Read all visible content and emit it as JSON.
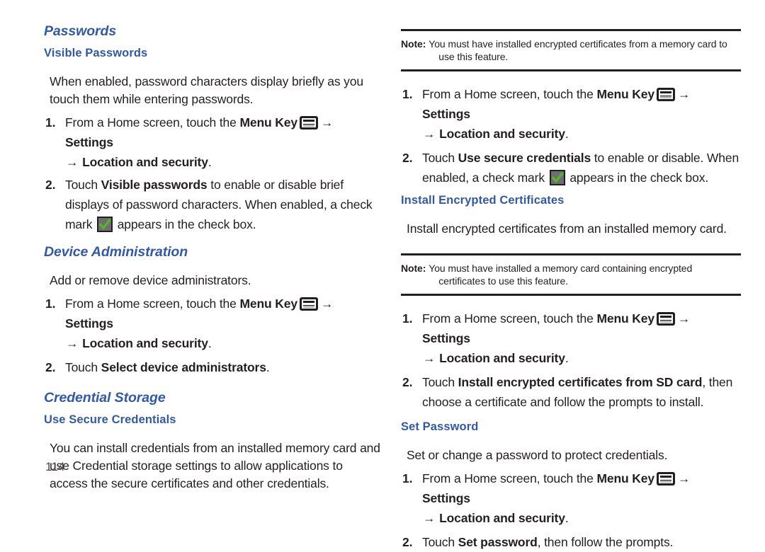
{
  "page": {
    "number": "114",
    "accent_color": "#3159a6",
    "text_color": "#231f20",
    "check_color": "#5ab031"
  },
  "icons": {
    "menu_key": "menu-key-icon",
    "check_box": "checkbox-checked-icon",
    "arrow": "→"
  },
  "left_column": {
    "heading_passwords": "Passwords",
    "subheading_visible_passwords": "Visible Passwords",
    "visible_passwords_intro": "When enabled, password characters display briefly as you touch them while entering passwords.",
    "vp_step1": {
      "num": "1.",
      "part_a": "From a Home screen, touch the ",
      "bold_menu_key": "Menu Key",
      "bold_settings": "Settings",
      "bold_location": "Location and security",
      "period": "."
    },
    "vp_step2": {
      "num": "2.",
      "part_a": "Touch ",
      "bold_target": "Visible passwords",
      "part_b": " to enable or disable brief displays of password characters. When enabled, a check mark ",
      "part_c": " appears in the check box."
    },
    "heading_device_administration": "Device Administration",
    "device_admin_intro": "Add or remove device administrators.",
    "da_step1": {
      "num": "1.",
      "part_a": "From a Home screen, touch the ",
      "bold_menu_key": "Menu Key",
      "bold_settings": "Settings",
      "bold_location": "Location and security",
      "period": "."
    },
    "da_step2": {
      "num": "2.",
      "part_a": "Touch ",
      "bold_target": "Select device administrators",
      "period": "."
    },
    "heading_credential_storage": "Credential Storage",
    "subheading_use_secure_credentials": "Use Secure Credentials",
    "use_secure_credentials_intro": "You can install credentials from an installed memory card and use Credential storage settings to allow applications to access the secure certificates and other credentials."
  },
  "right_column": {
    "note1": {
      "label": "Note:",
      "line1": "You must have installed encrypted certificates from a memory card to",
      "line2": "use this feature."
    },
    "usc_step1": {
      "num": "1.",
      "part_a": "From a Home screen, touch the ",
      "bold_menu_key": "Menu Key",
      "bold_settings": "Settings",
      "bold_location": "Location and security",
      "period": "."
    },
    "usc_step2": {
      "num": "2.",
      "part_a": "Touch ",
      "bold_target": "Use secure credentials",
      "part_b": " to enable or disable. When enabled, a check mark ",
      "part_c": " appears in the check box."
    },
    "subheading_install_encrypted_certificates": "Install Encrypted Certificates",
    "install_certificates_intro": "Install encrypted certificates from an installed memory card.",
    "note2": {
      "label": "Note:",
      "line1": "You must have installed a memory card containing encrypted",
      "line2": "certificates to use this feature."
    },
    "iec_step1": {
      "num": "1.",
      "part_a": "From a Home screen, touch the ",
      "bold_menu_key": "Menu Key",
      "bold_settings": "Settings",
      "bold_location": "Location and security",
      "period": "."
    },
    "iec_step2": {
      "num": "2.",
      "part_a": "Touch ",
      "bold_target": "Install encrypted certificates from SD card",
      "part_b": ", then choose a certificate and follow the prompts to install."
    },
    "subheading_set_password": "Set Password",
    "set_password_intro": "Set or change a password to protect credentials.",
    "sp_step1": {
      "num": "1.",
      "part_a": "From a Home screen, touch the ",
      "bold_menu_key": "Menu Key",
      "bold_settings": "Settings",
      "bold_location": "Location and security",
      "period": "."
    },
    "sp_step2": {
      "num": "2.",
      "part_a": "Touch ",
      "bold_target": "Set password",
      "part_b": ", then follow the prompts."
    }
  }
}
